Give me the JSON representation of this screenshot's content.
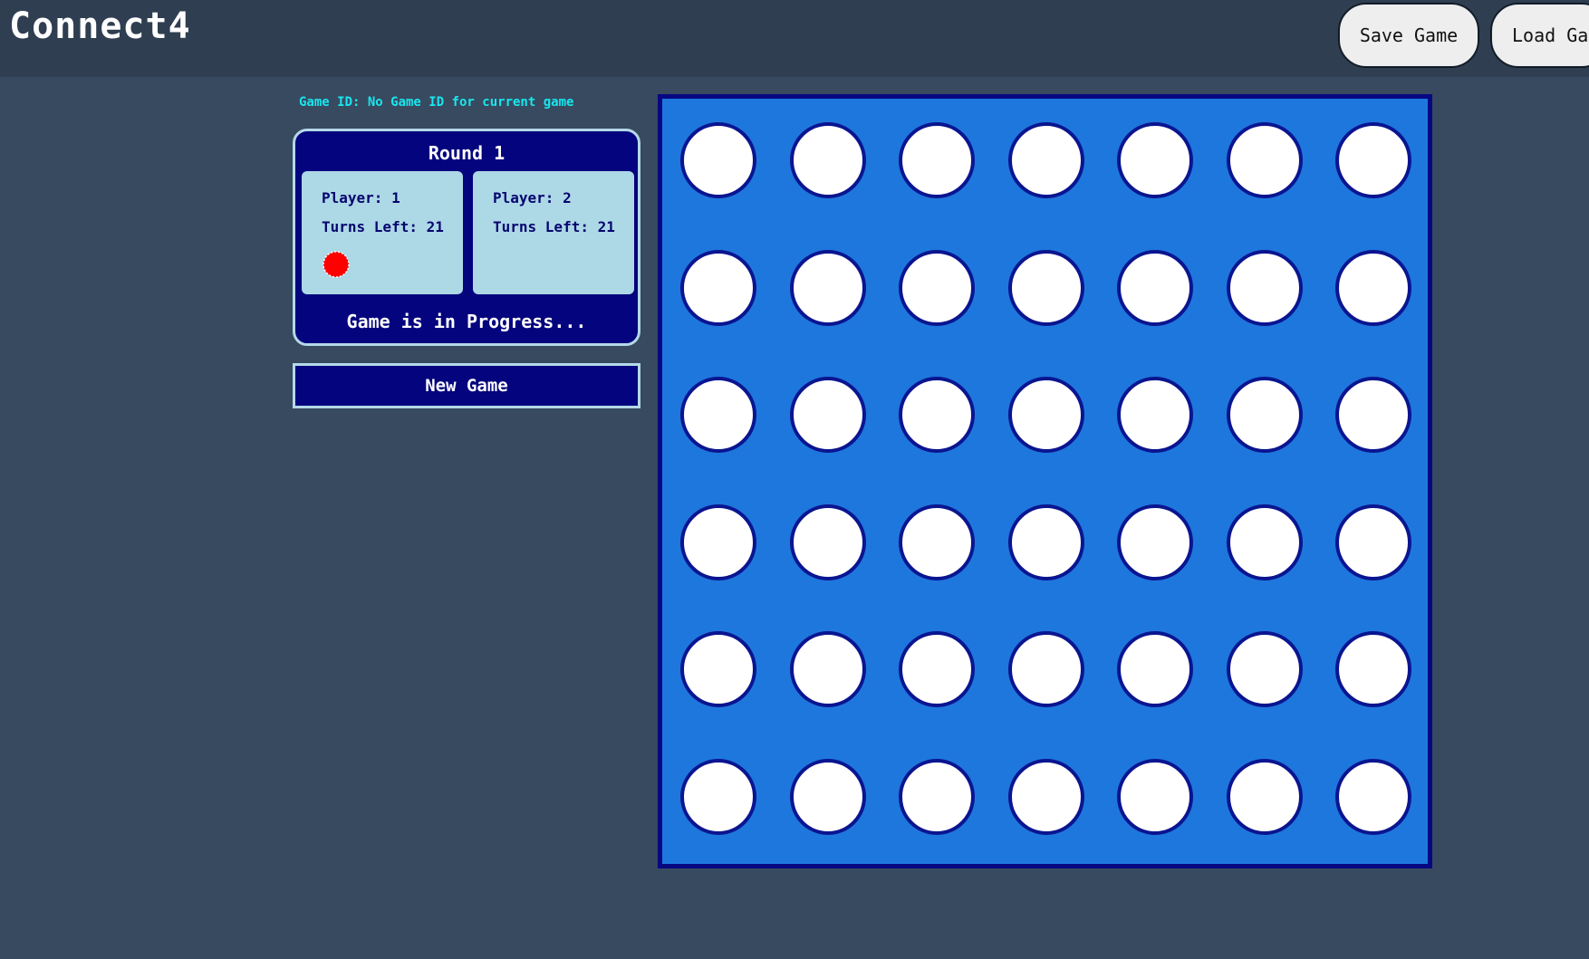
{
  "header": {
    "title": "Connect4",
    "save_label": "Save Game",
    "load_label": "Load Game"
  },
  "game_id_text": "Game ID: No Game ID for current game",
  "status": {
    "round_label": "Round 1",
    "players": [
      {
        "player_text": "Player: 1",
        "turns_text": "Turns Left: 21",
        "is_current_turn": true,
        "token_color": "#ff0000"
      },
      {
        "player_text": "Player: 2",
        "turns_text": "Turns Left: 21",
        "is_current_turn": false,
        "token_color": "#ffff00"
      }
    ],
    "message": "Game is in Progress..."
  },
  "new_game_label": "New Game",
  "board": {
    "rows": 6,
    "columns": 7,
    "cells": [
      [
        "empty",
        "empty",
        "empty",
        "empty",
        "empty",
        "empty",
        "empty"
      ],
      [
        "empty",
        "empty",
        "empty",
        "empty",
        "empty",
        "empty",
        "empty"
      ],
      [
        "empty",
        "empty",
        "empty",
        "empty",
        "empty",
        "empty",
        "empty"
      ],
      [
        "empty",
        "empty",
        "empty",
        "empty",
        "empty",
        "empty",
        "empty"
      ],
      [
        "empty",
        "empty",
        "empty",
        "empty",
        "empty",
        "empty",
        "empty"
      ],
      [
        "empty",
        "empty",
        "empty",
        "empty",
        "empty",
        "empty",
        "empty"
      ]
    ]
  },
  "colors": {
    "background": "#374a60",
    "header_bar": "#2f3e50",
    "panel": "#04047e",
    "panel_border": "#b4d8e8",
    "player_card": "#add8e6",
    "board": "#1e77dd",
    "board_border": "#070781",
    "empty_slot": "#ffffff",
    "game_id_text": "#19e6ee"
  }
}
